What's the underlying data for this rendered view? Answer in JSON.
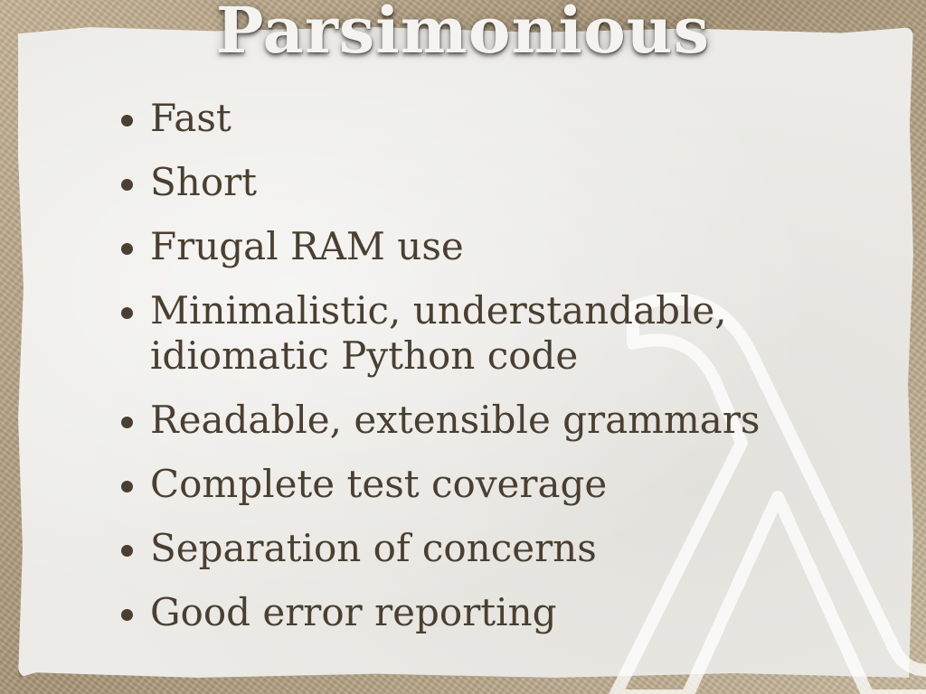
{
  "slide": {
    "title": "Parsimonious",
    "bullets": [
      "Fast",
      "Short",
      "Frugal RAM use",
      "Minimalistic, understandable,\nidiomatic Python code",
      "Readable, extensible grammars",
      "Complete test coverage",
      "Separation of concerns",
      "Good error reporting"
    ],
    "watermark_icon": "lambda-icon"
  },
  "colors": {
    "text": "#4a3f30",
    "title": "#f4f3ef",
    "paper": "#ecebe7",
    "background": "#b9a88c"
  }
}
